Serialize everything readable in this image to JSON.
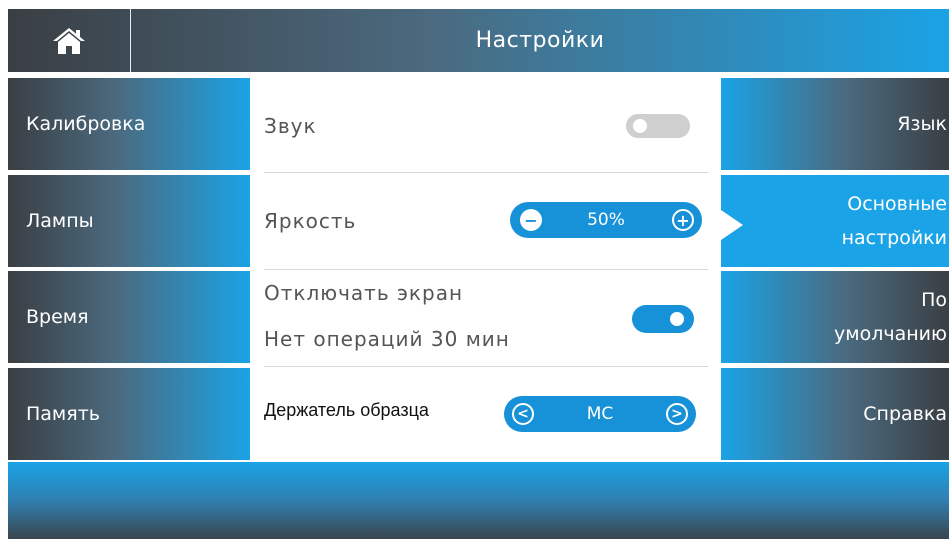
{
  "header": {
    "title": "Настройки",
    "home_icon": "home-icon"
  },
  "left_nav": [
    {
      "label": "Калибровка"
    },
    {
      "label": "Лампы"
    },
    {
      "label": "Время"
    },
    {
      "label": "Память"
    }
  ],
  "right_nav": [
    {
      "label": "Язык",
      "active": false
    },
    {
      "line1": "Основные",
      "line2": "настройки",
      "active": true
    },
    {
      "line1": "По",
      "line2": "умолчанию",
      "active": false
    },
    {
      "label": "Справка",
      "active": false
    }
  ],
  "settings": {
    "sound": {
      "label": "Звук",
      "enabled": false
    },
    "brightness": {
      "label": "Яркость",
      "value": "50%",
      "decrease_icon": "minus-icon",
      "increase_icon": "plus-icon"
    },
    "screen_off": {
      "label_line1": "Отключать экран",
      "label_line2": "Нет операций 30 мин",
      "enabled": true
    },
    "sample_holder": {
      "label": "Держатель образца",
      "value": "MC",
      "prev_icon": "chevron-left-icon",
      "next_icon": "chevron-right-icon"
    }
  },
  "colors": {
    "accent": "#1791d8",
    "toggle_off": "#cfcfcf",
    "dark": "#3a3f44",
    "bright_blue": "#1aa3e6"
  }
}
